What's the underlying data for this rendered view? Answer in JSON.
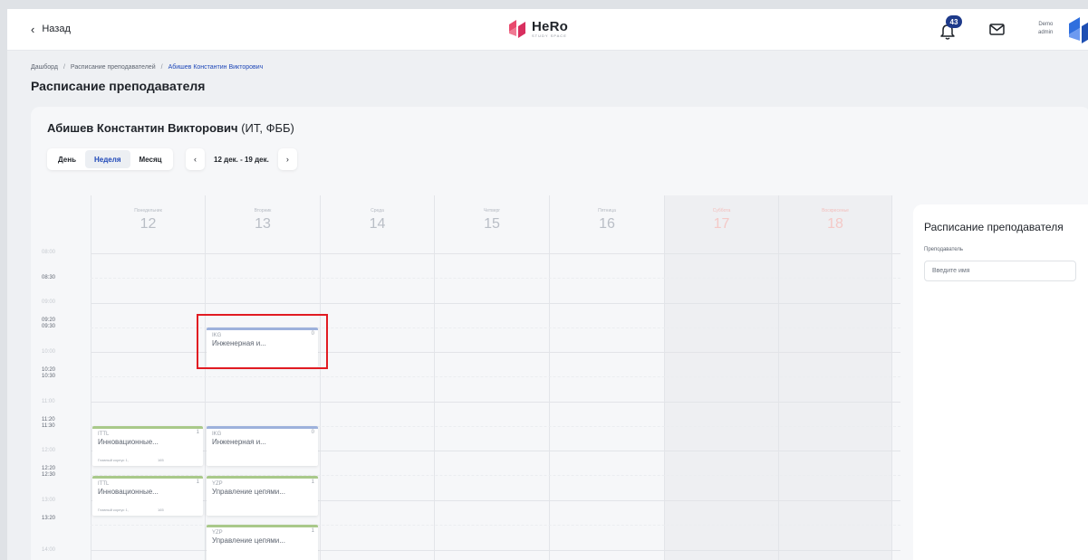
{
  "header": {
    "back_label": "Назад",
    "logo_name": "HeRo",
    "logo_sub": "STUDY SPACE",
    "notification_count": "43",
    "user_line1": "Demo",
    "user_line2": "admin"
  },
  "breadcrumb": {
    "items": [
      "Дашборд",
      "Расписание преподавателей",
      "Абишев Константин Викторович"
    ],
    "separator": "/"
  },
  "page_title": "Расписание преподавателя",
  "teacher": {
    "name": "Абишев Константин Викторович",
    "groups": "(ИТ, ФББ)"
  },
  "view_switch": {
    "day": "День",
    "week": "Неделя",
    "month": "Месяц",
    "active": "Неделя"
  },
  "date_nav": {
    "prev": "‹",
    "range": "12 дек. - 19 дек.",
    "next": "›"
  },
  "days": [
    {
      "name": "Понедельник",
      "num": "12"
    },
    {
      "name": "Вторник",
      "num": "13"
    },
    {
      "name": "Среда",
      "num": "14"
    },
    {
      "name": "Четверг",
      "num": "15"
    },
    {
      "name": "Пятница",
      "num": "16"
    },
    {
      "name": "Суббота",
      "num": "17"
    },
    {
      "name": "Воскресенье",
      "num": "18"
    }
  ],
  "time_labels": {
    "t0800": "08:00",
    "t0830": "08:30",
    "t0900": "09:00",
    "t0920": "09:20",
    "t0930": "09:30",
    "t1000": "10:00",
    "t1020": "10:20",
    "t1030": "10:30",
    "t1100": "11:00",
    "t1120": "11:20",
    "t1130": "11:30",
    "t1200": "12:00",
    "t1220": "12:20",
    "t1230": "12:30",
    "t1300": "13:00",
    "t1320": "13:20",
    "t1400": "14:00"
  },
  "events": {
    "tue_0930": {
      "code": "IKG",
      "title": "Инженерная и...",
      "count": "0"
    },
    "mon_1130": {
      "code": "ITTL",
      "title": "Инновационные...",
      "count": "1",
      "room": "Главный корпус 1,",
      "room_num": "165"
    },
    "tue_1130": {
      "code": "IKG",
      "title": "Инженерная и...",
      "count": "0"
    },
    "mon_1230": {
      "code": "ITTL",
      "title": "Инновационные...",
      "count": "1",
      "room": "Главный корпус 1,",
      "room_num": "165"
    },
    "tue_1230": {
      "code": "YZP",
      "title": "Управление цепями...",
      "count": "1"
    },
    "tue_1330": {
      "code": "YZP",
      "title": "Управление цепями...",
      "count": "1"
    }
  },
  "search_panel": {
    "title": "Расписание преподавателя",
    "label": "Преподаватель",
    "placeholder": "Введите имя"
  },
  "colors": {
    "accent": "#1f48b8",
    "event_blue": "#9db1dc",
    "event_green": "#a9c98a",
    "weekend_text": "#f4c9c7",
    "highlight": "#e11b22"
  }
}
